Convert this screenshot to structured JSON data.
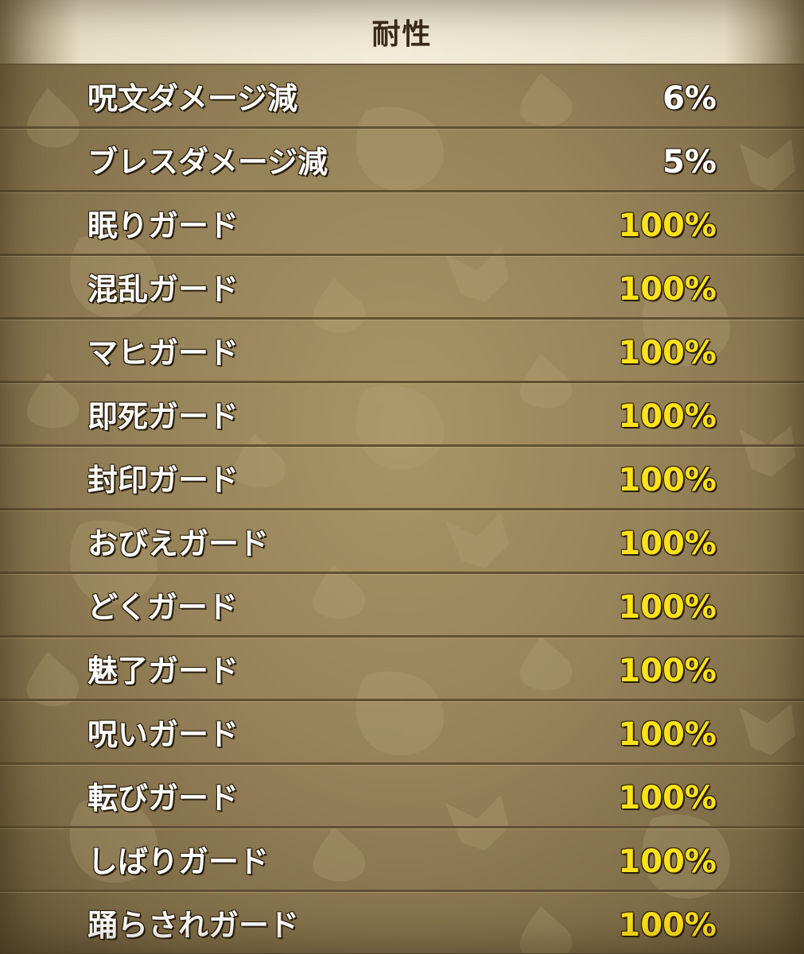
{
  "header": {
    "title": "耐性"
  },
  "colors": {
    "max_value": "#ffe21a",
    "normal_value": "#ffffff",
    "label": "#ffffff"
  },
  "resistances": [
    {
      "label": "呪文ダメージ減",
      "value": "6%",
      "max": false
    },
    {
      "label": "ブレスダメージ減",
      "value": "5%",
      "max": false
    },
    {
      "label": "眠りガード",
      "value": "100%",
      "max": true
    },
    {
      "label": "混乱ガード",
      "value": "100%",
      "max": true
    },
    {
      "label": "マヒガード",
      "value": "100%",
      "max": true
    },
    {
      "label": "即死ガード",
      "value": "100%",
      "max": true
    },
    {
      "label": "封印ガード",
      "value": "100%",
      "max": true
    },
    {
      "label": "おびえガード",
      "value": "100%",
      "max": true
    },
    {
      "label": "どくガード",
      "value": "100%",
      "max": true
    },
    {
      "label": "魅了ガード",
      "value": "100%",
      "max": true
    },
    {
      "label": "呪いガード",
      "value": "100%",
      "max": true
    },
    {
      "label": "転びガード",
      "value": "100%",
      "max": true
    },
    {
      "label": "しばりガード",
      "value": "100%",
      "max": true
    },
    {
      "label": "踊らされガード",
      "value": "100%",
      "max": true
    }
  ]
}
